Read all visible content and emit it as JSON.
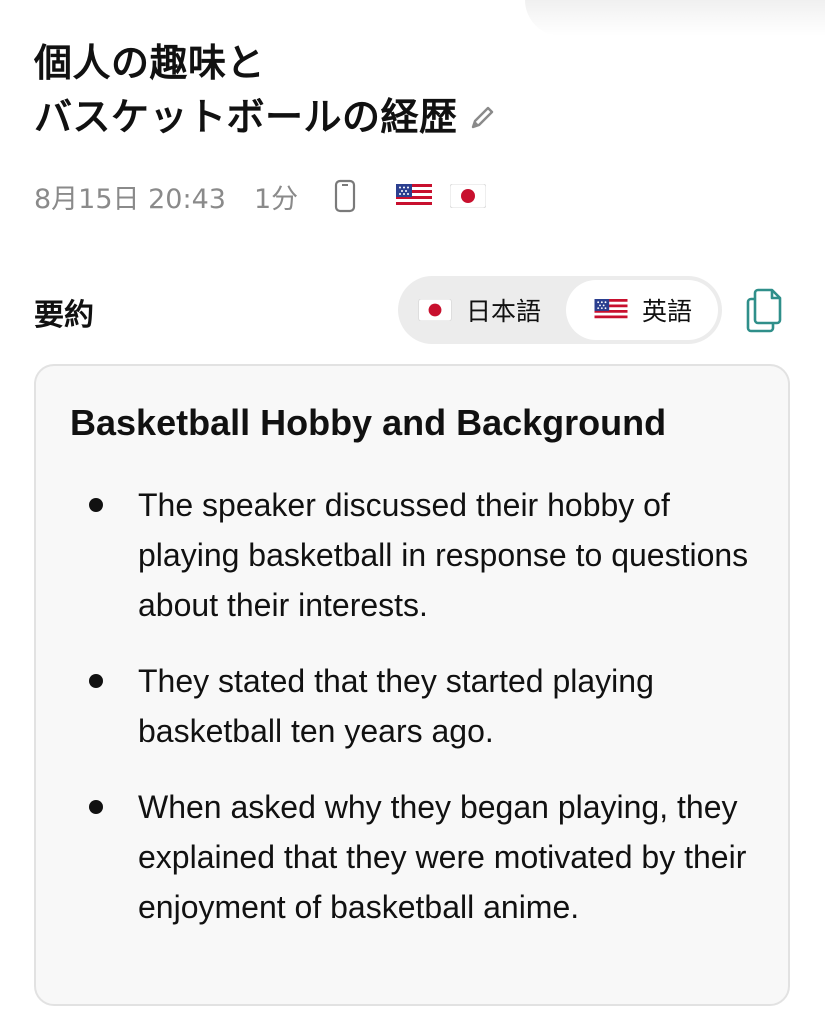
{
  "header": {
    "title_line1": "個人の趣味と",
    "title_line2": "バスケットボールの経歴",
    "edit_icon": "pencil-icon"
  },
  "meta": {
    "date": "8月15日 20:43",
    "duration": "1分",
    "device_icon": "phone-icon",
    "languages": [
      "us-flag",
      "jp-flag"
    ]
  },
  "summary": {
    "label": "要約",
    "lang_options": [
      {
        "flag": "jp-flag",
        "label": "日本語",
        "selected": false
      },
      {
        "flag": "us-flag",
        "label": "英語",
        "selected": true
      }
    ],
    "copy_icon": "copy-icon"
  },
  "card": {
    "title": "Basketball Hobby and Background",
    "bullets": [
      "The speaker discussed their hobby of playing basketball in response to questions about their interests.",
      "They stated that they started playing basketball ten years ago.",
      "When asked why they began playing, they explained that they were motivated by their enjoyment of basketball anime."
    ]
  },
  "colors": {
    "accent_teal": "#2f8f8a",
    "muted_text": "#8a8a8a",
    "toggle_bg": "#ececec",
    "card_bg": "#f8f8f8"
  }
}
